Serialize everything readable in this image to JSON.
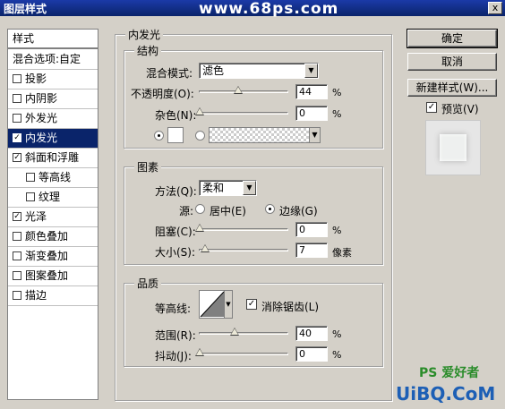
{
  "window": {
    "title": "图层样式",
    "watermark": "www.68ps.com",
    "close_label": "x"
  },
  "sidebar": {
    "header": "样式",
    "items": [
      {
        "label": "混合选项:自定",
        "checkbox": false,
        "checked": false
      },
      {
        "label": "投影",
        "checkbox": true,
        "checked": false
      },
      {
        "label": "内阴影",
        "checkbox": true,
        "checked": false
      },
      {
        "label": "外发光",
        "checkbox": true,
        "checked": false
      },
      {
        "label": "内发光",
        "checkbox": true,
        "checked": true,
        "selected": true
      },
      {
        "label": "斜面和浮雕",
        "checkbox": true,
        "checked": true
      },
      {
        "label": "等高线",
        "checkbox": true,
        "checked": false,
        "indent": true
      },
      {
        "label": "纹理",
        "checkbox": true,
        "checked": false,
        "indent": true
      },
      {
        "label": "光泽",
        "checkbox": true,
        "checked": true
      },
      {
        "label": "颜色叠加",
        "checkbox": true,
        "checked": false
      },
      {
        "label": "渐变叠加",
        "checkbox": true,
        "checked": false
      },
      {
        "label": "图案叠加",
        "checkbox": true,
        "checked": false
      },
      {
        "label": "描边",
        "checkbox": true,
        "checked": false
      }
    ]
  },
  "panel": {
    "title": "内发光",
    "structure": {
      "title": "结构",
      "blend_label": "混合模式:",
      "blend_value": "滤色",
      "opacity_label": "不透明度(O):",
      "opacity_value": "44",
      "opacity_unit": "%",
      "noise_label": "杂色(N):",
      "noise_value": "0",
      "noise_unit": "%"
    },
    "elements": {
      "title": "图素",
      "method_label": "方法(Q):",
      "method_value": "柔和",
      "source_label": "源:",
      "source_center": "居中(E)",
      "source_edge": "边缘(G)",
      "choke_label": "阻塞(C):",
      "choke_value": "0",
      "choke_unit": "%",
      "size_label": "大小(S):",
      "size_value": "7",
      "size_unit": "像素"
    },
    "quality": {
      "title": "品质",
      "contour_label": "等高线:",
      "antialias_label": "消除锯齿(L)",
      "range_label": "范围(R):",
      "range_value": "40",
      "range_unit": "%",
      "jitter_label": "抖动(J):",
      "jitter_value": "0",
      "jitter_unit": "%"
    }
  },
  "buttons": {
    "ok": "确定",
    "cancel": "取消",
    "new_style": "新建样式(W)...",
    "preview": "预览(V)"
  },
  "footer": {
    "logo": "PS 爱好者",
    "brand": "UiBQ.CoM"
  }
}
